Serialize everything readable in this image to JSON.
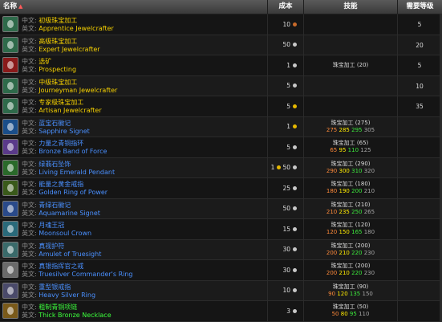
{
  "header": {
    "col_name": "名称",
    "col_cost": "成本",
    "col_skill": "技能",
    "col_level": "需要等级"
  },
  "labels": {
    "cn": "中文:",
    "en": "英文:"
  },
  "colors": {
    "header_bg": "#4a4a4a",
    "orange": "#ff8a3a",
    "yellow": "#ffeb00",
    "green": "#3ce83c",
    "gray": "#a5a5a5",
    "name_yellow": "#f5d000",
    "name_blue": "#4a90ff",
    "name_green": "#3cff3c",
    "copper": "#c86a2a",
    "silver": "#c8c8c8",
    "gold": "#e6b800"
  },
  "rows": [
    {
      "cn": "初级珠宝加工",
      "en": "Apprentice Jewelcrafter",
      "name_color": "#f5d000",
      "icon": "jewelcrafting-icon",
      "icon_color": "#2e6a4a",
      "cost": [
        {
          "v": "10",
          "coin": "copper"
        }
      ],
      "skill": "",
      "ranks": [],
      "level": "5"
    },
    {
      "cn": "高级珠宝加工",
      "en": "Expert Jewelcrafter",
      "name_color": "#f5d000",
      "icon": "jewelcrafting-icon",
      "icon_color": "#2e6a4a",
      "cost": [
        {
          "v": "50",
          "coin": "silver"
        }
      ],
      "skill": "",
      "ranks": [],
      "level": "20"
    },
    {
      "cn": "选矿",
      "en": "Prospecting",
      "name_color": "#f5d000",
      "icon": "prospecting-icon",
      "icon_color": "#8a1a1a",
      "cost": [
        {
          "v": "1",
          "coin": "silver"
        }
      ],
      "skill": "珠宝加工 (20)",
      "ranks": [],
      "level": "5"
    },
    {
      "cn": "中级珠宝加工",
      "en": "Journeyman Jewelcrafter",
      "name_color": "#f5d000",
      "icon": "jewelcrafting-icon",
      "icon_color": "#2e6a4a",
      "cost": [
        {
          "v": "5",
          "coin": "silver"
        }
      ],
      "skill": "",
      "ranks": [],
      "level": "10"
    },
    {
      "cn": "专家级珠宝加工",
      "en": "Artisan Jewelcrafter",
      "name_color": "#f5d000",
      "icon": "jewelcrafting-icon",
      "icon_color": "#2e6a4a",
      "cost": [
        {
          "v": "5",
          "coin": "gold"
        }
      ],
      "skill": "",
      "ranks": [],
      "level": "35"
    },
    {
      "cn": "蓝宝石徽记",
      "en": "Sapphire Signet",
      "name_color": "#4a90ff",
      "icon": "signet-icon",
      "icon_color": "#1a4e8a",
      "cost": [
        {
          "v": "1",
          "coin": "gold"
        }
      ],
      "skill": "珠宝加工 (275)",
      "ranks": [
        "275",
        "285",
        "295",
        "305"
      ],
      "level": ""
    },
    {
      "cn": "力量之青铜指环",
      "en": "Bronze Band of Force",
      "name_color": "#4a90ff",
      "icon": "ring-icon",
      "icon_color": "#5a3a8a",
      "cost": [
        {
          "v": "5",
          "coin": "silver"
        }
      ],
      "skill": "珠宝加工 (65)",
      "ranks": [
        "65",
        "95",
        "110",
        "125"
      ],
      "level": ""
    },
    {
      "cn": "绿翡石坠饰",
      "en": "Living Emerald Pendant",
      "name_color": "#4a90ff",
      "icon": "pendant-icon",
      "icon_color": "#2a6a2a",
      "cost": [
        {
          "v": "1",
          "coin": "gold"
        },
        {
          "v": "50",
          "coin": "silver"
        }
      ],
      "skill": "珠宝加工 (290)",
      "ranks": [
        "290",
        "300",
        "310",
        "320"
      ],
      "level": ""
    },
    {
      "cn": "能量之黄金戒指",
      "en": "Golden Ring of Power",
      "name_color": "#4a90ff",
      "icon": "ring-icon",
      "icon_color": "#3a5a1a",
      "cost": [
        {
          "v": "25",
          "coin": "silver"
        }
      ],
      "skill": "珠宝加工 (180)",
      "ranks": [
        "180",
        "190",
        "200",
        "210"
      ],
      "level": ""
    },
    {
      "cn": "青绿石徽记",
      "en": "Aquamarine Signet",
      "name_color": "#4a90ff",
      "icon": "signet-icon",
      "icon_color": "#2a4a8a",
      "cost": [
        {
          "v": "50",
          "coin": "silver"
        }
      ],
      "skill": "珠宝加工 (210)",
      "ranks": [
        "210",
        "235",
        "250",
        "265"
      ],
      "level": ""
    },
    {
      "cn": "月魂王冠",
      "en": "Moonsoul Crown",
      "name_color": "#4a90ff",
      "icon": "crown-icon",
      "icon_color": "#2a6a7a",
      "cost": [
        {
          "v": "15",
          "coin": "silver"
        }
      ],
      "skill": "珠宝加工 (120)",
      "ranks": [
        "120",
        "150",
        "165",
        "180"
      ],
      "level": ""
    },
    {
      "cn": "真视护符",
      "en": "Amulet of Truesight",
      "name_color": "#4a90ff",
      "icon": "amulet-icon",
      "icon_color": "#3a6a6a",
      "cost": [
        {
          "v": "30",
          "coin": "silver"
        }
      ],
      "skill": "珠宝加工 (200)",
      "ranks": [
        "200",
        "210",
        "220",
        "230"
      ],
      "level": ""
    },
    {
      "cn": "真银指挥官之戒",
      "en": "Truesilver Commander's Ring",
      "name_color": "#4a90ff",
      "icon": "ring-icon",
      "icon_color": "#6a6a6a",
      "cost": [
        {
          "v": "30",
          "coin": "silver"
        }
      ],
      "skill": "珠宝加工 (200)",
      "ranks": [
        "200",
        "210",
        "220",
        "230"
      ],
      "level": ""
    },
    {
      "cn": "重型银戒指",
      "en": "Heavy Silver Ring",
      "name_color": "#4a90ff",
      "icon": "ring-icon",
      "icon_color": "#4a4a6a",
      "cost": [
        {
          "v": "10",
          "coin": "silver"
        }
      ],
      "skill": "珠宝加工 (90)",
      "ranks": [
        "90",
        "120",
        "135",
        "150"
      ],
      "level": ""
    },
    {
      "cn": "粗制青铜项链",
      "en": "Thick Bronze Necklace",
      "name_color": "#3cff3c",
      "icon": "necklace-icon",
      "icon_color": "#7a5a1a",
      "cost": [
        {
          "v": "3",
          "coin": "silver"
        }
      ],
      "skill": "珠宝加工 (50)",
      "ranks": [
        "50",
        "80",
        "95",
        "110"
      ],
      "level": ""
    }
  ]
}
